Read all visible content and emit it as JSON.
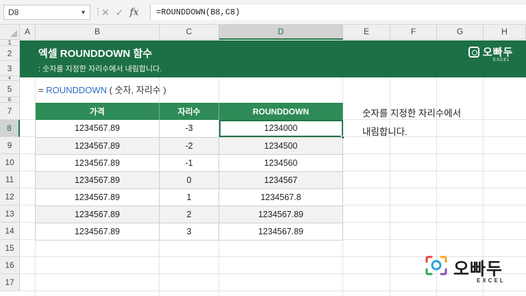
{
  "formula_bar": {
    "name_box": "D8",
    "formula": "=ROUNDDOWN(B8,C8)",
    "cancel_icon": "✕",
    "enter_icon": "✓",
    "fx_label": "fx"
  },
  "columns": [
    "A",
    "B",
    "C",
    "D",
    "E",
    "F",
    "G",
    "H"
  ],
  "rows": [
    "1",
    "2",
    "3",
    "4",
    "5",
    "6",
    "7",
    "8",
    "9",
    "10",
    "11",
    "12",
    "13",
    "14",
    "15",
    "16",
    "17"
  ],
  "banner": {
    "title": "엑셀 ROUNDDOWN 함수",
    "subtitle": ": 숫자를 지정한 자리수에서 내림합니다.",
    "logo_name": "오빠두",
    "logo_sub": "EXCEL"
  },
  "syntax": {
    "prefix": "= ",
    "function": "ROUNDDOWN",
    "args": " ( 숫자, 자리수 )"
  },
  "table": {
    "headers": [
      "가격",
      "자리수",
      "ROUNDDOWN"
    ],
    "rows": [
      [
        "1234567.89",
        "-3",
        "1234000"
      ],
      [
        "1234567.89",
        "-2",
        "1234500"
      ],
      [
        "1234567.89",
        "-1",
        "1234560"
      ],
      [
        "1234567.89",
        "0",
        "1234567"
      ],
      [
        "1234567.89",
        "1",
        "1234567.8"
      ],
      [
        "1234567.89",
        "2",
        "1234567.89"
      ],
      [
        "1234567.89",
        "3",
        "1234567.89"
      ]
    ]
  },
  "note": {
    "line1": "숫자를 지정한 자리수에서",
    "line2": "내림합니다."
  },
  "bottom_logo": {
    "name": "오빠두",
    "sub": "EXCEL"
  },
  "colors": {
    "banner": "#1d7045",
    "table_header": "#2e8b57",
    "selection": "#217346",
    "function_name": "#2b6cc4"
  }
}
